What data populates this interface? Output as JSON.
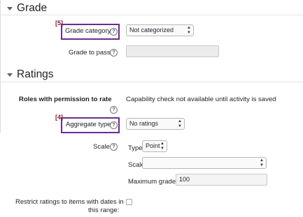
{
  "grade_section": {
    "title": "Grade",
    "grade_category_badge": "[5]",
    "grade_category_label": "Grade category",
    "grade_category_value": "Not categorized",
    "grade_to_pass_label": "Grade to pass",
    "grade_to_pass_value": ""
  },
  "ratings_section": {
    "title": "Ratings",
    "roles_label": "Roles with permission to rate",
    "roles_value": "Capability check not available until activity is saved",
    "aggregate_badge": "[4]",
    "aggregate_label": "Aggregate type",
    "aggregate_value": "No ratings",
    "scale_label": "Scale",
    "type_label": "Type",
    "type_value": "Point",
    "scale_sub_label": "Scale",
    "scale_sub_value": "",
    "max_grade_label": "Maximum grade",
    "max_grade_value": "100",
    "restrict_label_line1": "Restrict ratings to items with dates in",
    "restrict_label_line2": "this range:",
    "restrict_checked": false
  },
  "icons": {
    "help": "?",
    "collapse": "caret-down-icon"
  },
  "colors": {
    "highlight": "#6c2b8f",
    "badge": "#8a1a1a"
  }
}
